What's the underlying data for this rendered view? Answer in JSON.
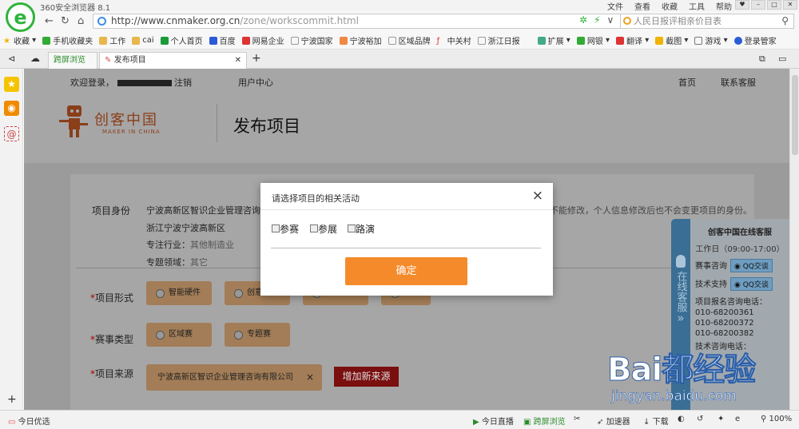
{
  "browser": {
    "app_title": "360安全浏览器 8.1",
    "menu": [
      "文件",
      "查看",
      "收藏",
      "工具",
      "帮助"
    ],
    "url_host": "http://www.cnmaker.org.cn",
    "url_path": "/zone/workscommit.html",
    "search_placeholder": "人民日报评相亲价目表",
    "bookmarks": [
      "收藏",
      "手机收藏夹",
      "工作",
      "cai",
      "个人首页",
      "百度",
      "网易企业",
      "宁波国家",
      "宁波裕加",
      "区域品牌",
      "中关村",
      "浙江日报"
    ],
    "toolbar_right": [
      "扩展",
      "网银",
      "翻译",
      "截图",
      "游戏",
      "登录管家"
    ],
    "tabs": [
      "跨屏浏览",
      "发布项目"
    ]
  },
  "site": {
    "welcome": "欢迎登录，",
    "logout": "注销",
    "user_center": "用户中心",
    "home": "首页",
    "contact": "联系客服",
    "logo_name": "创客中国",
    "logo_sub": "MAKER IN CHINA",
    "page_title": "发布项目"
  },
  "form": {
    "identity_label": "项目身份",
    "org_name": "宁波高新区智识企业管理咨询有",
    "notice": "不能修改，个人信息修改后也不会变更项目的身份。",
    "region": "浙江宁波宁波高新区",
    "industry_label": "专注行业：",
    "industry_value": "其他制造业",
    "field_label": "专题领域：",
    "field_value": "其它",
    "form_label": "项目形式",
    "form_options": [
      "智能硬件",
      "创意设计",
      "移动应用",
      "其它"
    ],
    "type_label": "赛事类型",
    "type_options": [
      "区域赛",
      "专题赛"
    ],
    "source_label": "项目来源",
    "source_tag": "宁波高新区智识企业管理咨询有限公司",
    "source_remove": "×",
    "add_source": "增加新来源",
    "required_mark": "*"
  },
  "modal": {
    "title": "请选择项目的相关活动",
    "close": "×",
    "options": [
      "参赛",
      "参展",
      "路演"
    ],
    "confirm": "确定"
  },
  "service": {
    "side_text": "在线客服",
    "side_arrow": "»",
    "title": "创客中国在线客服",
    "hours": "工作日（09:00-17:00）",
    "contest_label": "赛事咨询",
    "tech_label": "技术支持",
    "qq": "QQ交谈",
    "phone_label": "项目报名咨询电话：",
    "phones": [
      "010-68200361",
      "010-68200372",
      "010-68200382"
    ],
    "tech_phone_label": "技术咨询电话："
  },
  "status": {
    "left": "今日优选",
    "items": [
      "今日直播",
      "跨屏浏览",
      "加速器",
      "下载"
    ],
    "zoom": "100%"
  },
  "watermark": {
    "text": "Bai都经验",
    "url": "jingyan.baidu.com"
  }
}
